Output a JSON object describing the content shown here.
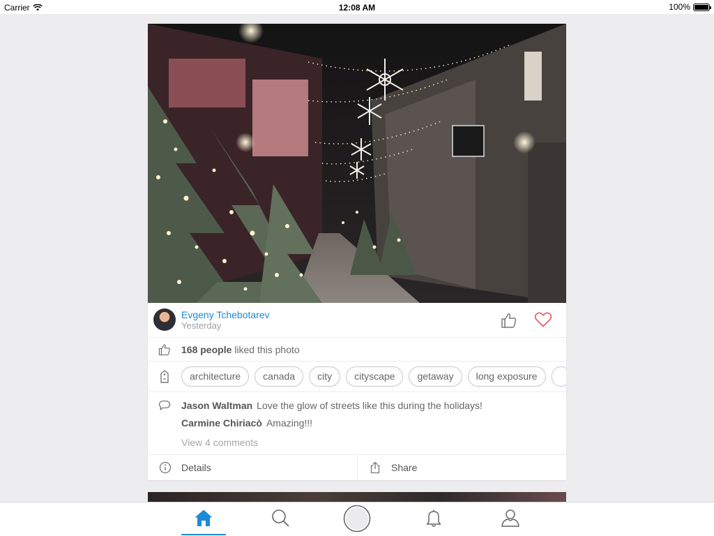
{
  "status_bar": {
    "carrier": "Carrier",
    "time": "12:08 AM",
    "battery": "100%",
    "battery_level": 1.0
  },
  "post": {
    "photo_icon": "photo-winter-street",
    "author": {
      "name": "Evgeny Tchebotarev",
      "time": "Yesterday"
    },
    "likes": {
      "count": "168 people",
      "suffix": " liked this photo"
    },
    "tags": [
      "architecture",
      "canada",
      "city",
      "cityscape",
      "getaway",
      "long exposure"
    ],
    "comments": [
      {
        "author": "Jason Waltman",
        "text": "Love the glow of streets like this during the holidays!"
      },
      {
        "author": "Carmine Chiriacò",
        "text": "Amazing!!!"
      }
    ],
    "view_comments": "View 4 comments",
    "actions": {
      "details": "Details",
      "share": "Share"
    }
  },
  "tab_bar": {
    "items": [
      {
        "icon": "home-icon",
        "active": true
      },
      {
        "icon": "search-icon",
        "active": false
      },
      {
        "icon": "camera-button-icon",
        "active": false
      },
      {
        "icon": "bell-icon",
        "active": false
      },
      {
        "icon": "profile-icon",
        "active": false
      }
    ]
  },
  "colors": {
    "accent": "#1c8ad6",
    "heart": "#e8505b",
    "background": "#ededf0"
  }
}
